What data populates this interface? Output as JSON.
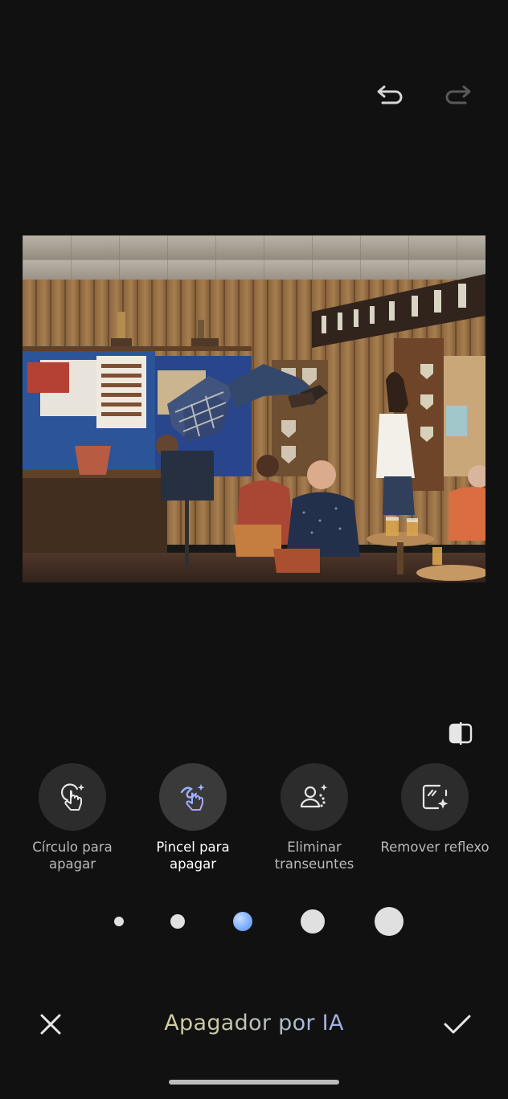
{
  "header": {
    "undo_icon": "undo-icon",
    "redo_icon": "redo-icon"
  },
  "photo": {
    "description_icon": "photo-preview"
  },
  "compare_icon": "compare-icon",
  "tools": [
    {
      "label": "Círculo para\napagar",
      "icon": "circle-erase-icon",
      "active": false
    },
    {
      "label": "Pincel para\napagar",
      "icon": "brush-erase-icon",
      "active": true
    },
    {
      "label": "Eliminar\ntranseuntes",
      "icon": "remove-people-icon",
      "active": false
    },
    {
      "label": "Remover reflexo",
      "icon": "remove-reflection-icon",
      "active": false
    }
  ],
  "brush_sizes": {
    "selected_index": 2,
    "count": 5
  },
  "bottom_bar": {
    "title": "Apagador por IA",
    "close_icon": "close-icon",
    "confirm_icon": "check-icon"
  },
  "colors": {
    "background": "#111111",
    "tool_circle": "#2c2c2c",
    "accent_blue": "#7fb0ff",
    "title_gradient_start": "#e4d79a",
    "title_gradient_end": "#8ea4f2"
  }
}
